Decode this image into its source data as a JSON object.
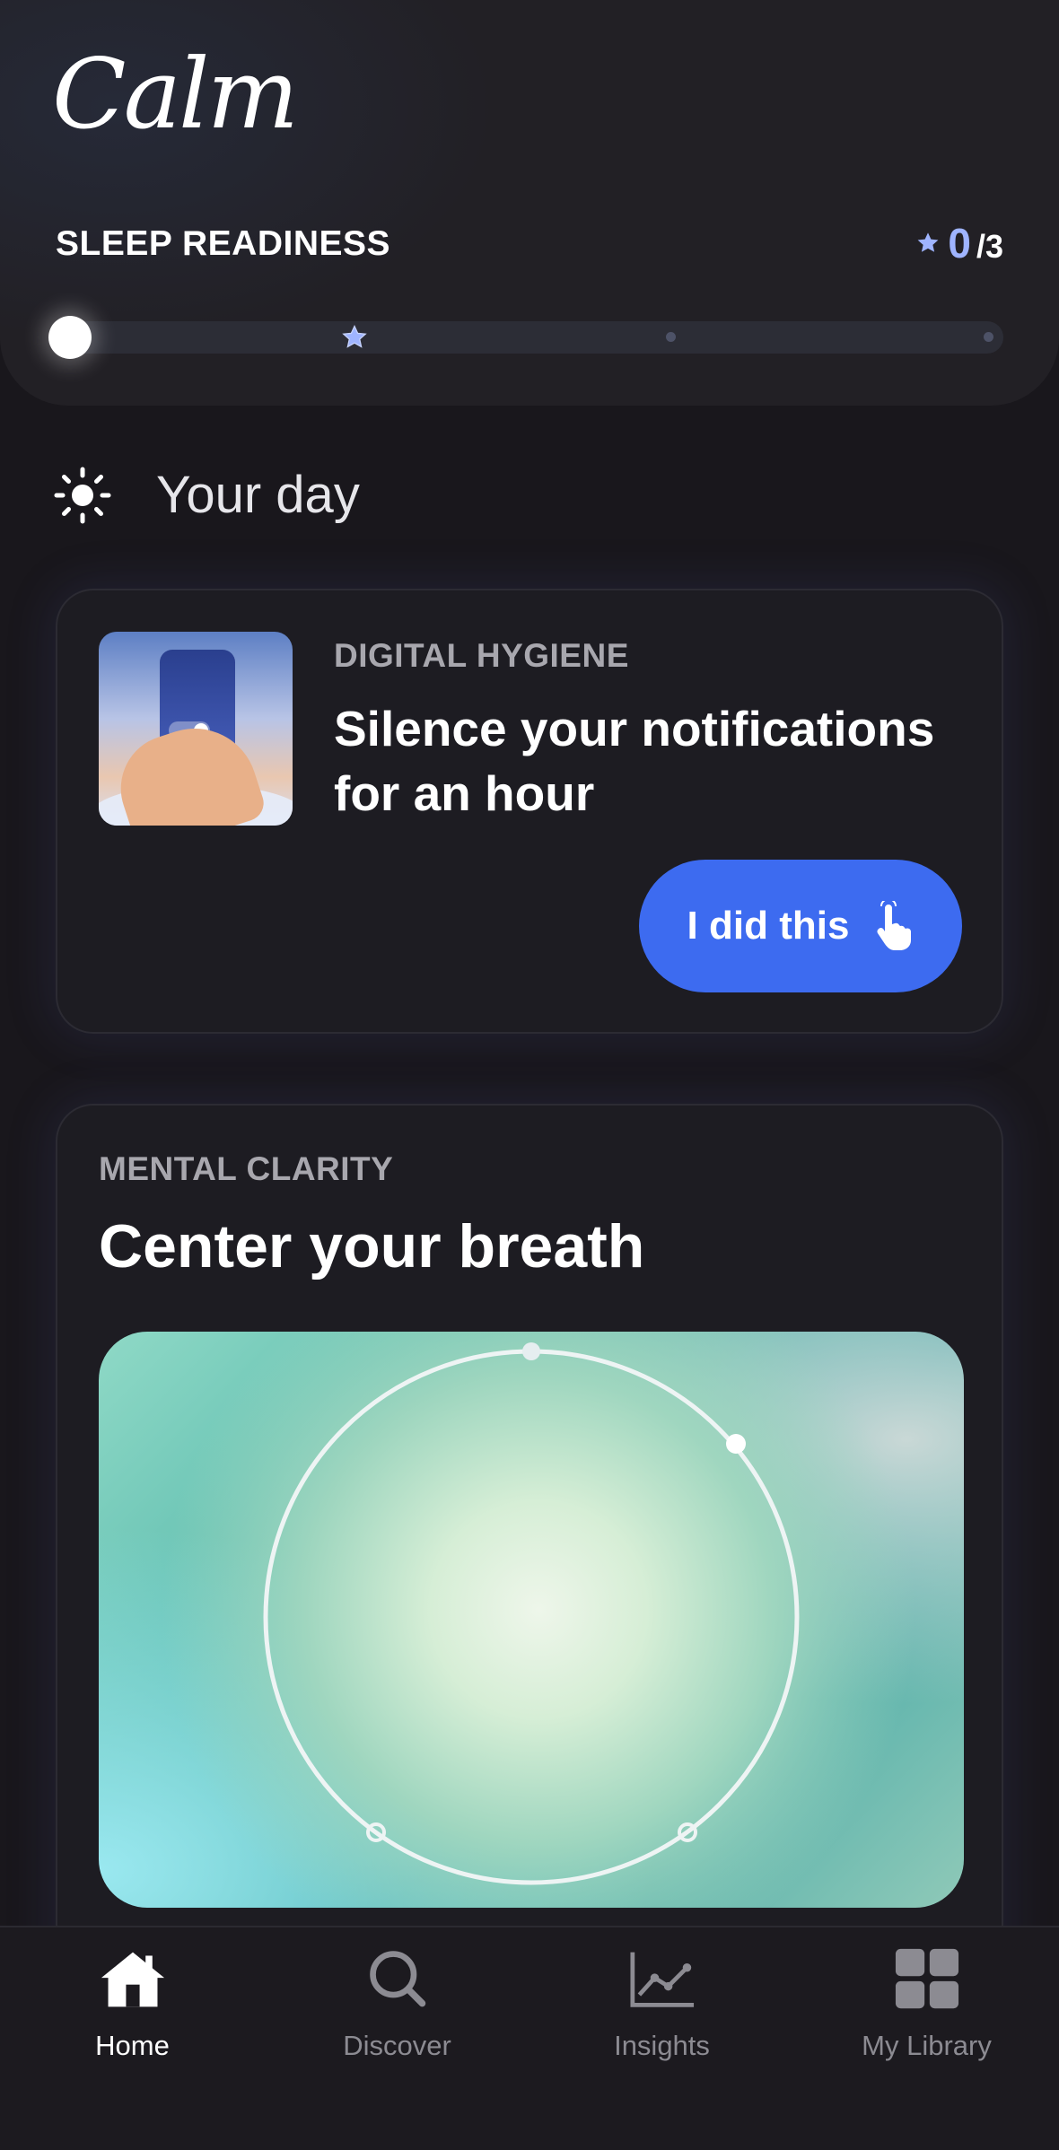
{
  "app": {
    "logo": "Calm"
  },
  "sleep_readiness": {
    "title": "SLEEP READINESS",
    "score_current": "0",
    "score_max": "/3",
    "progress_fraction": 0
  },
  "your_day": {
    "label": "Your day"
  },
  "cards": [
    {
      "category": "DIGITAL HYGIENE",
      "title": "Silence your notifications for an hour",
      "button_label": "I did this"
    },
    {
      "category": "MENTAL CLARITY",
      "title": "Center your breath"
    }
  ],
  "nav": {
    "items": [
      {
        "label": "Home",
        "icon": "home-icon",
        "active": true
      },
      {
        "label": "Discover",
        "icon": "search-icon",
        "active": false
      },
      {
        "label": "Insights",
        "icon": "chart-icon",
        "active": false
      },
      {
        "label": "My Library",
        "icon": "grid-icon",
        "active": false
      }
    ]
  },
  "colors": {
    "accent_blue": "#3d6bf0",
    "star_blue": "#9fb4ff",
    "background": "#19171c"
  }
}
